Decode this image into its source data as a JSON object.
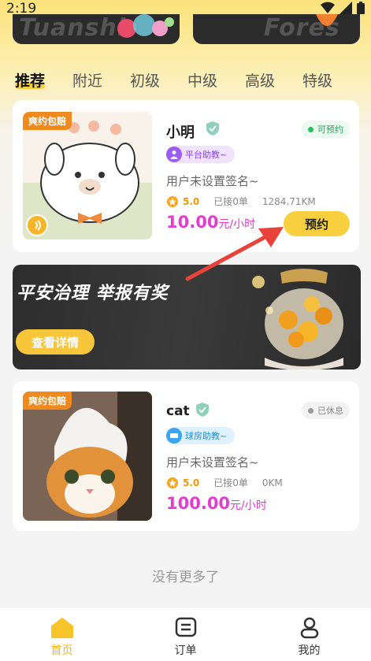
{
  "status_bar": {
    "time": "2:19"
  },
  "top_banners": [
    {
      "ghost_text": "Tuanshi"
    },
    {
      "ghost_text": "Fores"
    }
  ],
  "tabs": [
    {
      "label": "推荐",
      "active": true
    },
    {
      "label": "附近"
    },
    {
      "label": "初级"
    },
    {
      "label": "中级"
    },
    {
      "label": "高级"
    },
    {
      "label": "特级"
    }
  ],
  "cards": [
    {
      "promo_tag": "爽约包赔",
      "name": "小明",
      "status": "可预约",
      "role_badge": "平台助教~",
      "signature": "用户未设置签名~",
      "rating": "5.0",
      "orders": "已接0单",
      "distance": "1284.71KM",
      "price": "10.00",
      "price_unit": "元/小时",
      "book_label": "预约"
    },
    {
      "promo_tag": "爽约包赔",
      "name": "cat",
      "status": "已休息",
      "role_badge": "球房助教~",
      "signature": "用户未设置签名~",
      "rating": "5.0",
      "orders": "已接0单",
      "distance": "0KM",
      "price": "100.00",
      "price_unit": "元/小时"
    }
  ],
  "promo_banner": {
    "title": "平安治理 举报有奖",
    "button": "查看详情"
  },
  "footer_text": "没有更多了",
  "bottom_nav": [
    {
      "label": "首页",
      "icon": "home-icon",
      "active": true
    },
    {
      "label": "订单",
      "icon": "order-icon"
    },
    {
      "label": "我的",
      "icon": "profile-icon"
    }
  ],
  "colors": {
    "accent": "#f8cf3e",
    "price": "#e23dcd",
    "tag": "#f08a1c",
    "available": "#25a55a",
    "arrow": "#e8423b"
  }
}
